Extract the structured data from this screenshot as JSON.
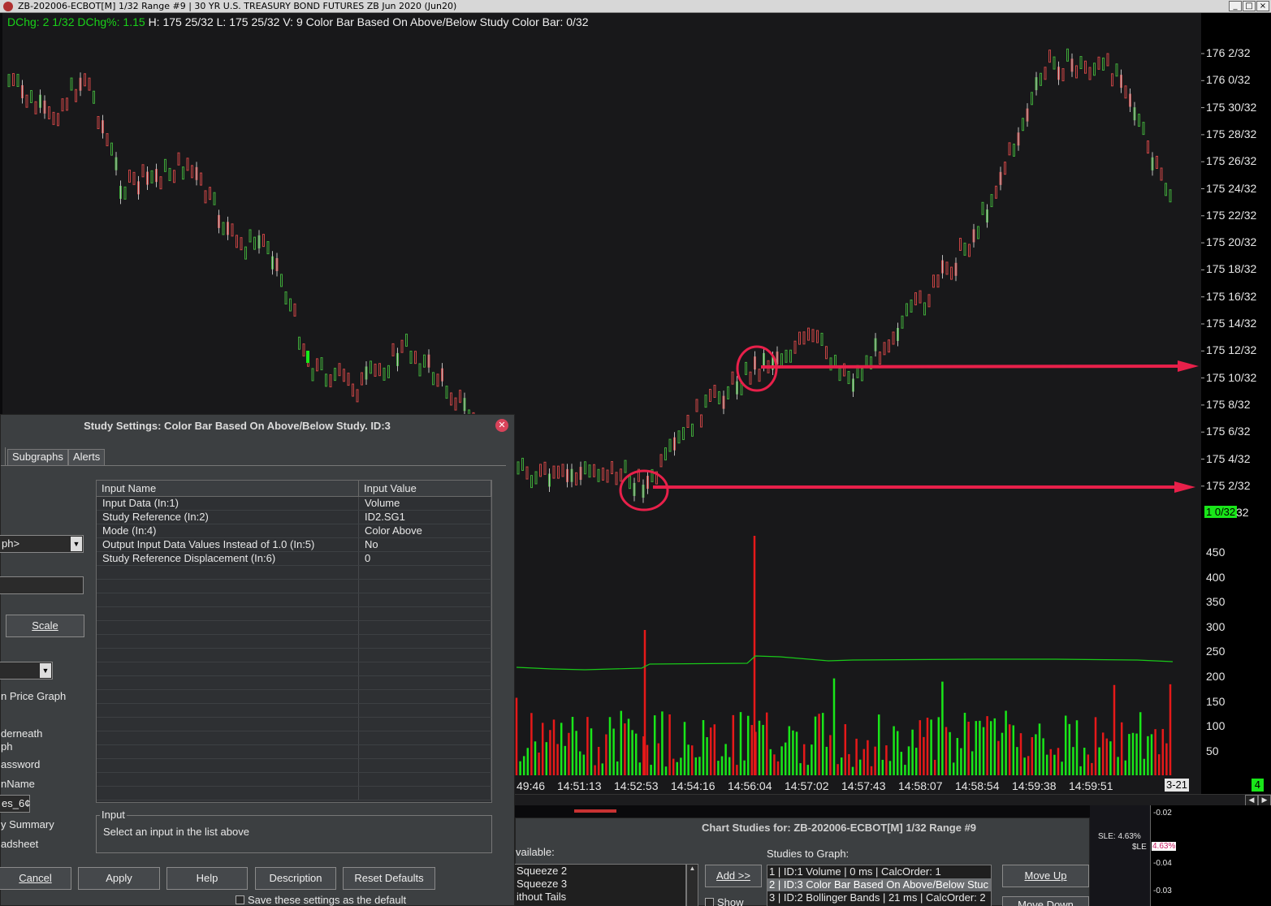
{
  "window": {
    "title": "ZB-202006-ECBOT[M]  1/32 Range  #9 |  30 YR U.S. TREASURY BOND FUTURES ZB  Jun 2020 (Jun20)",
    "buttons": [
      "_",
      "□",
      "×"
    ]
  },
  "info_line": {
    "dchg": "DChg: 2 1/32",
    "dchg_pct": "DChg%: 1.15",
    "rest": "H: 175 25/32 L: 175 25/32 V: 9 Color Bar Based On Above/Below Study  Color Bar: 0/32",
    "green": "#19d219",
    "white": "#f0f0f0"
  },
  "price_scale": [
    "176 2/32",
    "176 0/32",
    "175 30/32",
    "175 28/32",
    "175 26/32",
    "175 24/32",
    "175 22/32",
    "175 20/32",
    "175 18/32",
    "175 16/32",
    "175 14/32",
    "175 12/32",
    "175 10/32",
    "175 8/32",
    "175 6/32",
    "175 4/32",
    "175 2/32"
  ],
  "last_price_tag": {
    "value": "1 0/32",
    "tail": "32"
  },
  "volume_scale": [
    "450",
    "400",
    "350",
    "300",
    "250",
    "200",
    "150",
    "100",
    "50"
  ],
  "time_axis": [
    "49:46",
    "14:51:13",
    "14:52:53",
    "14:54:16",
    "14:56:04",
    "14:57:02",
    "14:57:43",
    "14:58:07",
    "14:58:54",
    "14:59:38",
    "14:59:51"
  ],
  "time_axis_end": "3-21",
  "badge": "4",
  "colors": {
    "up": "#3fa83a",
    "down": "#c84444",
    "annotation": "#e8204a",
    "vol_green": "#19e619",
    "vol_red": "#e61919",
    "ma": "#19c819"
  },
  "study_dialog": {
    "title": "Study Settings: Color Bar Based On Above/Below Study. ID:3",
    "close_icon": "close-icon",
    "tabs": [
      "Subgraphs",
      "Alerts"
    ],
    "columns": [
      "Input Name",
      "Input Value"
    ],
    "rows": [
      [
        "Input Data   (In:1)",
        "Volume"
      ],
      [
        "Study Reference   (In:2)",
        "ID2.SG1"
      ],
      [
        "Mode   (In:4)",
        "Color Above"
      ],
      [
        "Output Input Data Values Instead of 1.0   (In:5)",
        "No"
      ],
      [
        "Study Reference Displacement   (In:6)",
        "0"
      ]
    ],
    "input_group_label": "Input",
    "input_group_text": "Select an input in the list above",
    "side": {
      "select1": "ph>",
      "scale_button": "Scale",
      "price_graph": "n Price Graph",
      "underneath": "derneath",
      "graph": "ph",
      "password": "assword",
      "name": "nName",
      "field_value": "es_6¢",
      "summary": "y Summary",
      "spreadsheet": "adsheet"
    },
    "buttons": {
      "cancel": "Cancel",
      "apply": "Apply",
      "help": "Help",
      "description": "Description",
      "reset": "Reset Defaults"
    },
    "save_default": "Save these settings as the default"
  },
  "chart_studies": {
    "title": "Chart Studies for: ZB-202006-ECBOT[M]  1/32 Range  #9",
    "available_label": "vailable:",
    "available": [
      "Squeeze 2",
      "Squeeze 3",
      "ithout Tails"
    ],
    "add_button": "Add >>",
    "show_label": "Show",
    "to_graph_label": "Studies to Graph:",
    "to_graph": [
      "1 | ID:1  Volume | 0 ms | CalcOrder: 1",
      "2 | ID:3  Color Bar Based On Above/Below Stuc",
      "3 | ID:2  Bollinger Bands | 21 ms | CalcOrder: 2"
    ],
    "move_up": "Move Up",
    "move_down": "Move Down"
  },
  "right_panel": {
    "v1": "-0.02",
    "v2": "-0.04",
    "v3": "-0.03",
    "sle": "SLE: 4.63%",
    "le": "$LE",
    "tag": "4.63%"
  }
}
